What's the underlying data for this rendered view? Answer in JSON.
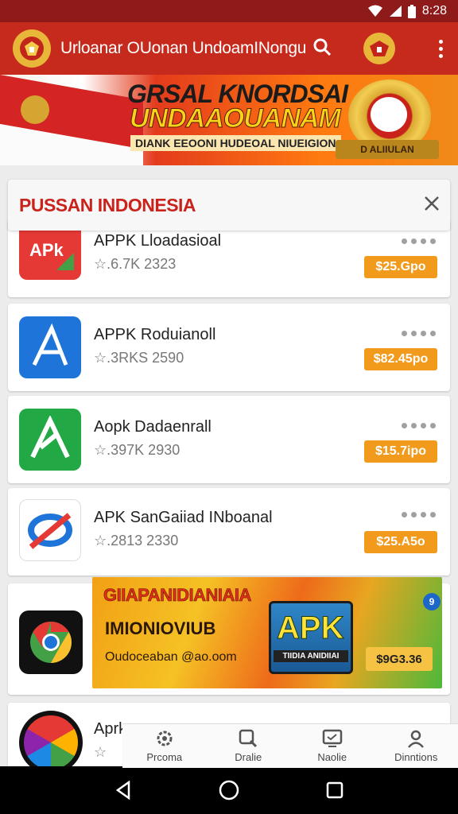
{
  "status_bar": {
    "time": "8:28"
  },
  "app_bar": {
    "title": "Urloanar OUonan UndoamINongu"
  },
  "hero": {
    "line1": "GRSAL KNORDSAI",
    "line2": "UNDAAOUANAM",
    "line3": "DIANK EEOONI HUDEOAL NIUEIGION",
    "ribbon": "D ALIIULAN"
  },
  "panel": {
    "title": "PUSSAN INDONESIA"
  },
  "apps": [
    {
      "name": "APPK Lloadasioal",
      "meta": "☆.6.7K 2323",
      "price": "$25.Gpo",
      "icon_color": "#e53935"
    },
    {
      "name": "APPK Roduianoll",
      "meta": "☆.3RKS 2590",
      "price": "$82.45po",
      "icon_color": "#1e74d8"
    },
    {
      "name": "Aopk Dadaenrall",
      "meta": "☆.397K 2930",
      "price": "$15.7ipo",
      "icon_color": "#22a845"
    },
    {
      "name": "APK SanGaiiad INboanal",
      "meta": "☆.2813 2330",
      "price": "$25.A5o",
      "icon_color": "#ffffff"
    }
  ],
  "promo": {
    "line1": "GIIAPANIDIANIAIA",
    "line2": "IMIONIOVIUB",
    "line3": "Oudoceaban @ao.oom",
    "apk_text": "APK",
    "apk_sub": "TIIDIA ANIDIIAI",
    "price": "$9G3.36",
    "badge": "9"
  },
  "last_app": {
    "name": "Aprk",
    "meta": "☆"
  },
  "tabs": [
    {
      "label": "Prcoma",
      "icon": "gear-icon"
    },
    {
      "label": "Dralie",
      "icon": "search-icon"
    },
    {
      "label": "Naolie",
      "icon": "screen-icon"
    },
    {
      "label": "Dinntions",
      "icon": "person-icon"
    }
  ]
}
